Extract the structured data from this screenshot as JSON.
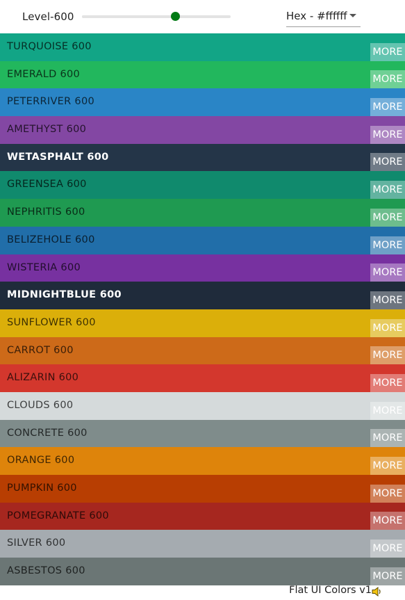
{
  "toolbar": {
    "level_label": "Level-600",
    "slider_value": 0.625,
    "format_value": "Hex - #ffffff",
    "slider_color": "#007a14"
  },
  "colors": [
    {
      "name": "TURQUOISE 600",
      "hex": "#12a586",
      "text": "dark"
    },
    {
      "name": "EMERALD 600",
      "hex": "#22b75d",
      "text": "dark"
    },
    {
      "name": "PETERRIVER 600",
      "hex": "#2a85c6",
      "text": "dark"
    },
    {
      "name": "AMETHYST 600",
      "hex": "#8347a3",
      "text": "dark"
    },
    {
      "name": "WETASPHALT 600",
      "hex": "#243548",
      "text": "light"
    },
    {
      "name": "GREENSEA 600",
      "hex": "#108a6d",
      "text": "dark"
    },
    {
      "name": "NEPHRITIS 600",
      "hex": "#1f9a51",
      "text": "dark"
    },
    {
      "name": "BELIZEHOLE 600",
      "hex": "#216ea9",
      "text": "dark"
    },
    {
      "name": "WISTERIA 600",
      "hex": "#7731a0",
      "text": "dark"
    },
    {
      "name": "MIDNIGHTBLUE 600",
      "hex": "#1f2b3b",
      "text": "light"
    },
    {
      "name": "SUNFLOWER 600",
      "hex": "#dbaf0a",
      "text": "dark"
    },
    {
      "name": "CARROT 600",
      "hex": "#cd6a19",
      "text": "dark"
    },
    {
      "name": "ALIZARIN 600",
      "hex": "#d3372d",
      "text": "dark"
    },
    {
      "name": "CLOUDS 600",
      "hex": "#d5dadb",
      "text": "dark"
    },
    {
      "name": "CONCRETE 600",
      "hex": "#7f8c8b",
      "text": "dark"
    },
    {
      "name": "ORANGE 600",
      "hex": "#de840b",
      "text": "dark"
    },
    {
      "name": "PUMPKIN 600",
      "hex": "#b83e02",
      "text": "dark"
    },
    {
      "name": "POMEGRANATE 600",
      "hex": "#a6271f",
      "text": "dark"
    },
    {
      "name": "SILVER 600",
      "hex": "#a5abb0",
      "text": "dark"
    },
    {
      "name": "ASBESTOS 600",
      "hex": "#6b7675",
      "text": "dark"
    }
  ],
  "more_label": "MORE",
  "footer": {
    "title": "Flat UI Colors v1",
    "icon": "speaker-icon"
  }
}
